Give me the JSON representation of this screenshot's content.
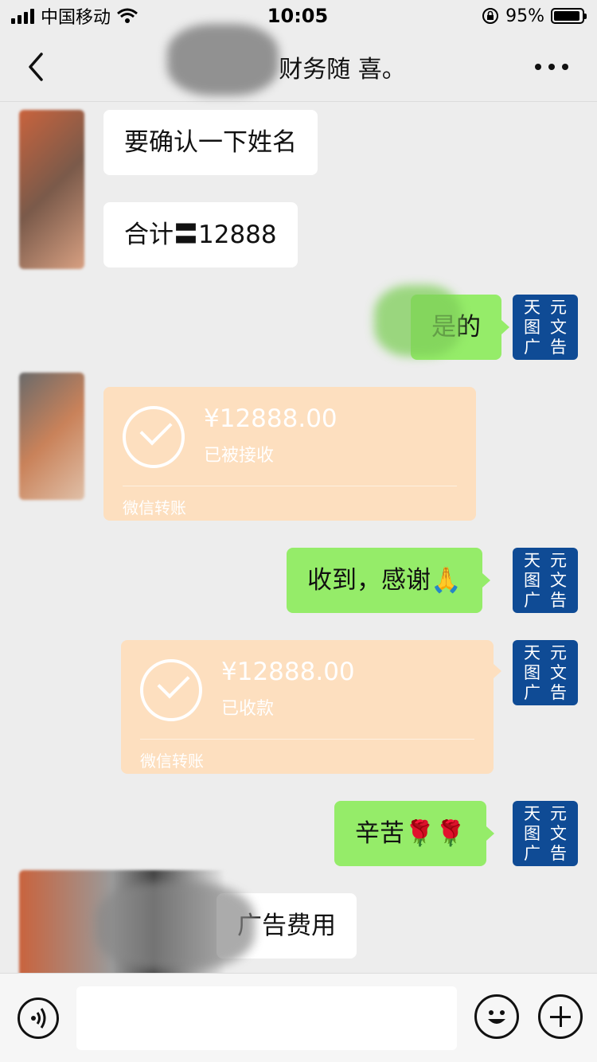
{
  "status_bar": {
    "carrier": "中国移动",
    "time": "10:05",
    "battery_percent": "95%",
    "battery_level": 0.95
  },
  "nav": {
    "title": "财务随 喜。",
    "back_icon": "chevron-left-icon",
    "more_icon": "ellipsis-icon"
  },
  "messages": [
    {
      "side": "left",
      "type": "text",
      "text": "要确认一下姓名"
    },
    {
      "side": "left",
      "type": "text",
      "text": "合计〓12888"
    },
    {
      "side": "right",
      "type": "text",
      "text": "是的"
    },
    {
      "side": "left",
      "type": "transfer",
      "amount": "¥12888.00",
      "status": "已被接收",
      "footer": "微信转账"
    },
    {
      "side": "right",
      "type": "text",
      "text": "收到，感谢🙏"
    },
    {
      "side": "right",
      "type": "transfer",
      "amount": "¥12888.00",
      "status": "已收款",
      "footer": "微信转账"
    },
    {
      "side": "right",
      "type": "text",
      "text": "辛苦🌹🌹"
    },
    {
      "side": "left",
      "type": "text",
      "text": "广告费用"
    }
  ],
  "avatar_right": {
    "chars": [
      "天",
      "元",
      "图",
      "文",
      "广",
      "告"
    ]
  },
  "input_bar": {
    "voice_icon": "voice-icon",
    "input_value": "",
    "emoji_icon": "emoji-icon",
    "plus_icon": "plus-icon"
  },
  "colors": {
    "chat_bg": "#ededed",
    "right_bubble": "#95ec69",
    "left_bubble": "#ffffff",
    "transfer_bg": "#fddfbf",
    "avatar_bg": "#0f4b95"
  }
}
